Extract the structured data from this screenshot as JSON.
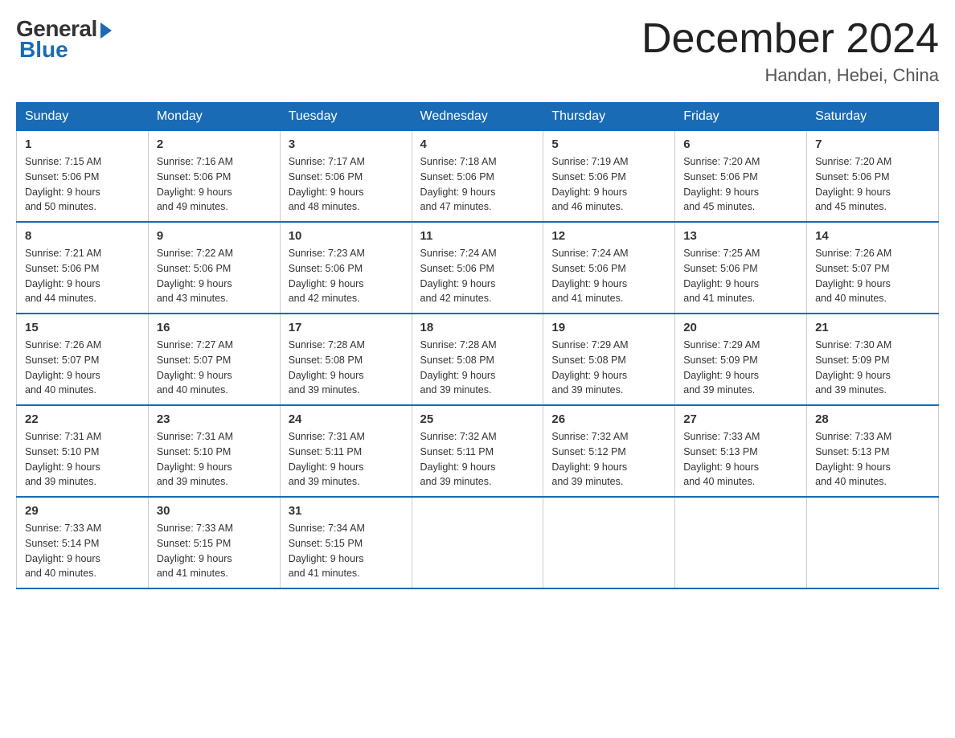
{
  "logo": {
    "general": "General",
    "blue": "Blue"
  },
  "title": "December 2024",
  "subtitle": "Handan, Hebei, China",
  "days_of_week": [
    "Sunday",
    "Monday",
    "Tuesday",
    "Wednesday",
    "Thursday",
    "Friday",
    "Saturday"
  ],
  "weeks": [
    [
      {
        "day": "1",
        "sunrise": "7:15 AM",
        "sunset": "5:06 PM",
        "daylight": "9 hours and 50 minutes."
      },
      {
        "day": "2",
        "sunrise": "7:16 AM",
        "sunset": "5:06 PM",
        "daylight": "9 hours and 49 minutes."
      },
      {
        "day": "3",
        "sunrise": "7:17 AM",
        "sunset": "5:06 PM",
        "daylight": "9 hours and 48 minutes."
      },
      {
        "day": "4",
        "sunrise": "7:18 AM",
        "sunset": "5:06 PM",
        "daylight": "9 hours and 47 minutes."
      },
      {
        "day": "5",
        "sunrise": "7:19 AM",
        "sunset": "5:06 PM",
        "daylight": "9 hours and 46 minutes."
      },
      {
        "day": "6",
        "sunrise": "7:20 AM",
        "sunset": "5:06 PM",
        "daylight": "9 hours and 45 minutes."
      },
      {
        "day": "7",
        "sunrise": "7:20 AM",
        "sunset": "5:06 PM",
        "daylight": "9 hours and 45 minutes."
      }
    ],
    [
      {
        "day": "8",
        "sunrise": "7:21 AM",
        "sunset": "5:06 PM",
        "daylight": "9 hours and 44 minutes."
      },
      {
        "day": "9",
        "sunrise": "7:22 AM",
        "sunset": "5:06 PM",
        "daylight": "9 hours and 43 minutes."
      },
      {
        "day": "10",
        "sunrise": "7:23 AM",
        "sunset": "5:06 PM",
        "daylight": "9 hours and 42 minutes."
      },
      {
        "day": "11",
        "sunrise": "7:24 AM",
        "sunset": "5:06 PM",
        "daylight": "9 hours and 42 minutes."
      },
      {
        "day": "12",
        "sunrise": "7:24 AM",
        "sunset": "5:06 PM",
        "daylight": "9 hours and 41 minutes."
      },
      {
        "day": "13",
        "sunrise": "7:25 AM",
        "sunset": "5:06 PM",
        "daylight": "9 hours and 41 minutes."
      },
      {
        "day": "14",
        "sunrise": "7:26 AM",
        "sunset": "5:07 PM",
        "daylight": "9 hours and 40 minutes."
      }
    ],
    [
      {
        "day": "15",
        "sunrise": "7:26 AM",
        "sunset": "5:07 PM",
        "daylight": "9 hours and 40 minutes."
      },
      {
        "day": "16",
        "sunrise": "7:27 AM",
        "sunset": "5:07 PM",
        "daylight": "9 hours and 40 minutes."
      },
      {
        "day": "17",
        "sunrise": "7:28 AM",
        "sunset": "5:08 PM",
        "daylight": "9 hours and 39 minutes."
      },
      {
        "day": "18",
        "sunrise": "7:28 AM",
        "sunset": "5:08 PM",
        "daylight": "9 hours and 39 minutes."
      },
      {
        "day": "19",
        "sunrise": "7:29 AM",
        "sunset": "5:08 PM",
        "daylight": "9 hours and 39 minutes."
      },
      {
        "day": "20",
        "sunrise": "7:29 AM",
        "sunset": "5:09 PM",
        "daylight": "9 hours and 39 minutes."
      },
      {
        "day": "21",
        "sunrise": "7:30 AM",
        "sunset": "5:09 PM",
        "daylight": "9 hours and 39 minutes."
      }
    ],
    [
      {
        "day": "22",
        "sunrise": "7:31 AM",
        "sunset": "5:10 PM",
        "daylight": "9 hours and 39 minutes."
      },
      {
        "day": "23",
        "sunrise": "7:31 AM",
        "sunset": "5:10 PM",
        "daylight": "9 hours and 39 minutes."
      },
      {
        "day": "24",
        "sunrise": "7:31 AM",
        "sunset": "5:11 PM",
        "daylight": "9 hours and 39 minutes."
      },
      {
        "day": "25",
        "sunrise": "7:32 AM",
        "sunset": "5:11 PM",
        "daylight": "9 hours and 39 minutes."
      },
      {
        "day": "26",
        "sunrise": "7:32 AM",
        "sunset": "5:12 PM",
        "daylight": "9 hours and 39 minutes."
      },
      {
        "day": "27",
        "sunrise": "7:33 AM",
        "sunset": "5:13 PM",
        "daylight": "9 hours and 40 minutes."
      },
      {
        "day": "28",
        "sunrise": "7:33 AM",
        "sunset": "5:13 PM",
        "daylight": "9 hours and 40 minutes."
      }
    ],
    [
      {
        "day": "29",
        "sunrise": "7:33 AM",
        "sunset": "5:14 PM",
        "daylight": "9 hours and 40 minutes."
      },
      {
        "day": "30",
        "sunrise": "7:33 AM",
        "sunset": "5:15 PM",
        "daylight": "9 hours and 41 minutes."
      },
      {
        "day": "31",
        "sunrise": "7:34 AM",
        "sunset": "5:15 PM",
        "daylight": "9 hours and 41 minutes."
      },
      null,
      null,
      null,
      null
    ]
  ],
  "labels": {
    "sunrise": "Sunrise:",
    "sunset": "Sunset:",
    "daylight": "Daylight:"
  }
}
